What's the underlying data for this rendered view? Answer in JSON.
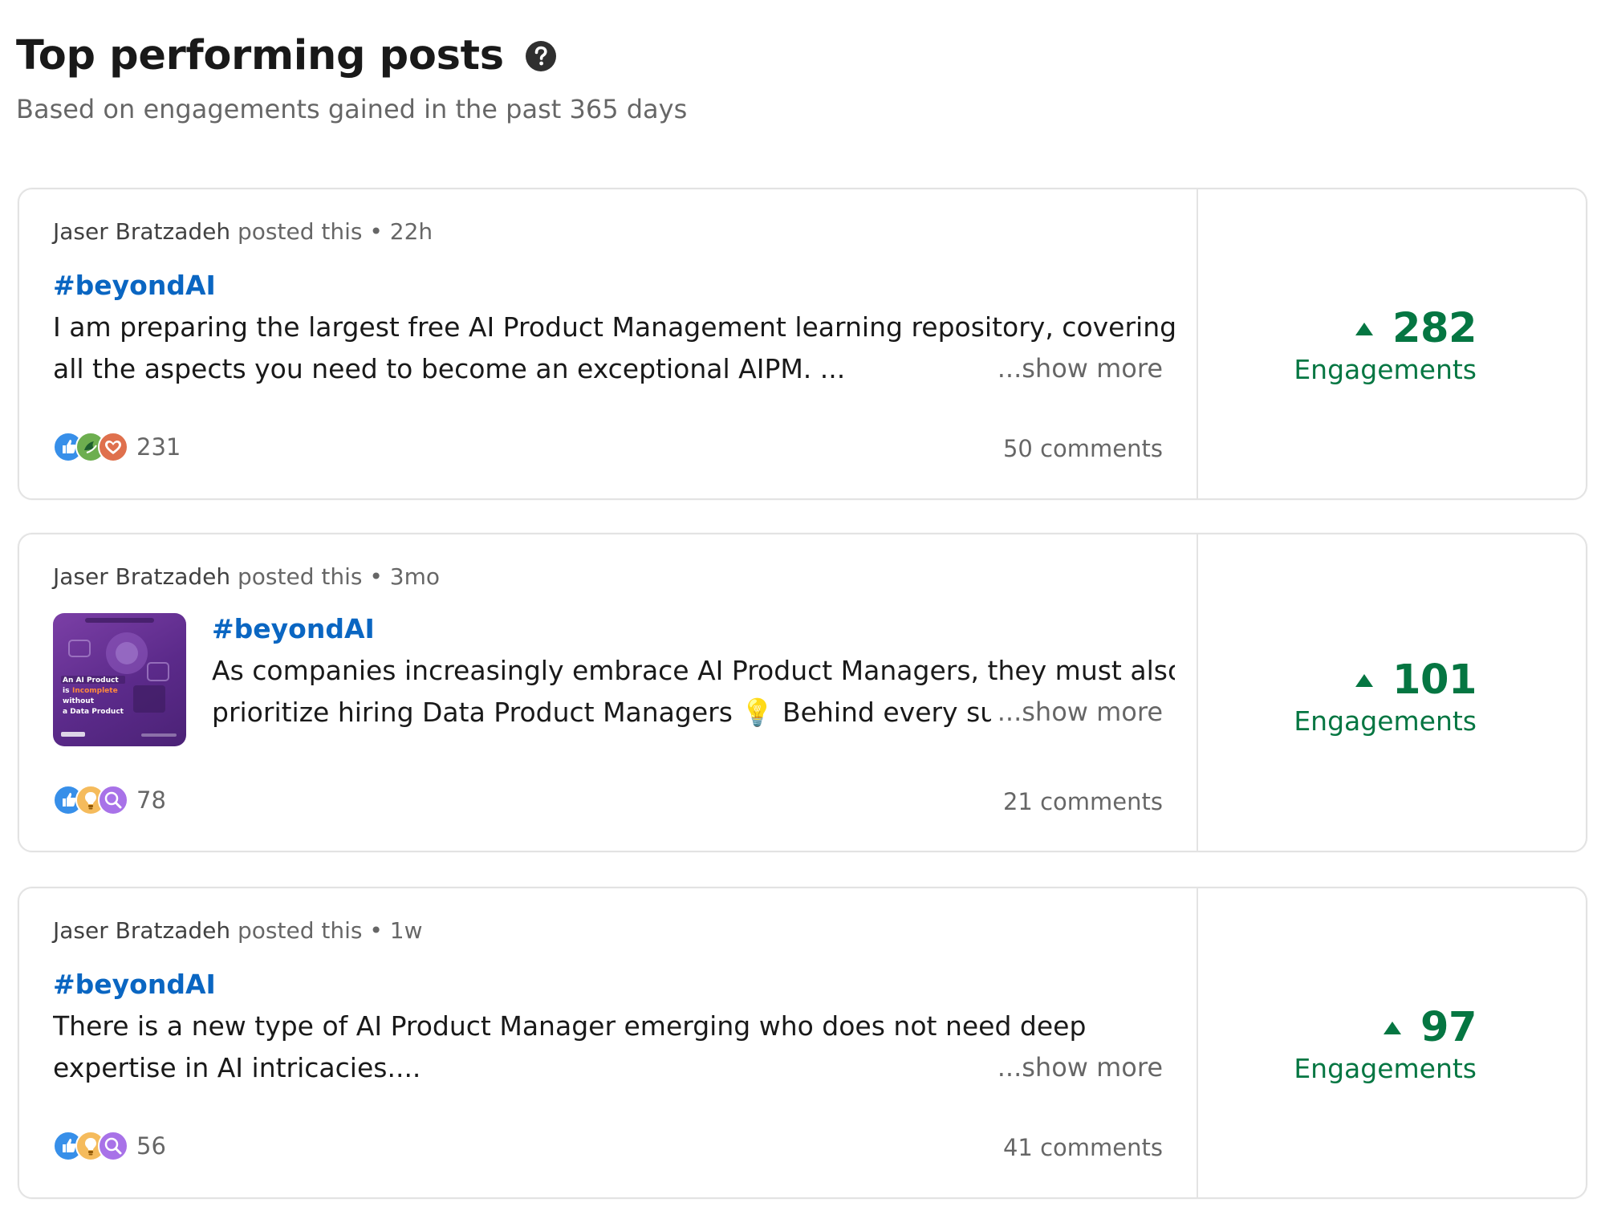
{
  "header": {
    "title": "Top performing posts",
    "subtitle": "Based on engagements gained in the past 365 days"
  },
  "posts": [
    {
      "author": "Jaser Bratzadeh",
      "meta_suffix": "posted this • 22h",
      "hashtag": "#beyondAI",
      "line1": "I am preparing the largest free AI Product Management learning repository, covering",
      "line2": "all the aspects you need to become an exceptional AIPM. ...",
      "show_more": "...show more",
      "reactions": [
        "like",
        "support",
        "love"
      ],
      "reaction_count": "231",
      "comments": "50 comments",
      "engagements": "282",
      "engagements_label": "Engagements"
    },
    {
      "author": "Jaser Bratzadeh",
      "meta_suffix": "posted this • 3mo",
      "hashtag": "#beyondAI",
      "line1": "As companies increasingly embrace AI Product Managers, they must also",
      "line2": "prioritize hiring Data Product Managers 💡 Behind every su",
      "show_more": "...show more",
      "thumbnail_text": "An AI Product is Incomplete without a Data Product",
      "reactions": [
        "like",
        "insightful",
        "curious"
      ],
      "reaction_count": "78",
      "comments": "21 comments",
      "engagements": "101",
      "engagements_label": "Engagements"
    },
    {
      "author": "Jaser Bratzadeh",
      "meta_suffix": "posted this • 1w",
      "hashtag": "#beyondAI",
      "line1": "There is a new type of AI Product Manager emerging who does not need deep",
      "line2": "expertise in AI intricacies....",
      "show_more": "...show more",
      "reactions": [
        "like",
        "insightful",
        "curious"
      ],
      "reaction_count": "56",
      "comments": "41 comments",
      "engagements": "97",
      "engagements_label": "Engagements"
    }
  ],
  "colors": {
    "link": "#0a66c2",
    "engagement_green": "#057642",
    "muted_text": "#666666"
  },
  "icons": {
    "help": "question-circle-icon",
    "trend": "triangle-up-icon",
    "reactions": {
      "like": "like-icon",
      "support": "support-icon",
      "love": "love-icon",
      "insightful": "lightbulb-icon",
      "curious": "curious-icon"
    }
  }
}
